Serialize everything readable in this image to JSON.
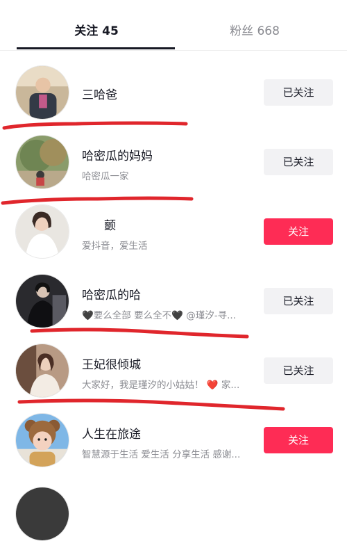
{
  "tabs": {
    "following": "关注 45",
    "followers": "粉丝 668"
  },
  "users": [
    {
      "name": "三哈爸",
      "desc": "",
      "button": "已关注"
    },
    {
      "name": "哈密瓜的妈妈",
      "desc": "哈密瓜一家",
      "button": "已关注"
    },
    {
      "name": "颤",
      "desc": "爱抖音，爱生活",
      "button": "关注"
    },
    {
      "name": "哈密瓜的哈",
      "desc": "🖤要么全部 要么全不🖤 @瑾汐-寻...",
      "button": "已关注"
    },
    {
      "name": "王妃很倾城",
      "desc": "大家好，我是瑾汐的小姑姑！ ❤️ 家...",
      "button": "已关注"
    },
    {
      "name": "人生在旅途",
      "desc": "智慧源于生活 爱生活 分享生活 感谢...",
      "button": "关注"
    }
  ],
  "colors": {
    "follow_accent": "#fe2c55",
    "annotation_red": "#e0262c"
  }
}
